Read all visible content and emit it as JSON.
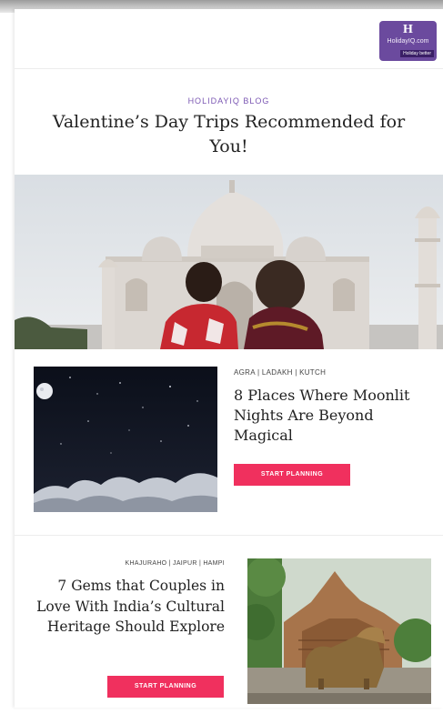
{
  "logo": {
    "mark": "H",
    "name": "HolidayIQ.com",
    "tagline": "Holiday better"
  },
  "header": {
    "eyebrow": "HOLIDAYIQ BLOG",
    "headline": "Valentine’s Day Trips Recommended for You!"
  },
  "articles": [
    {
      "tags": "AGRA | LADAKH | KUTCH",
      "title": "8 Places Where Moonlit Nights Are Beyond Magical",
      "cta": "START PLANNING"
    },
    {
      "tags": "KHAJURAHO | JAIPUR | HAMPI",
      "title": "7 Gems that Couples in Love With India’s Cultural Heritage Should Explore",
      "cta": "START PLANNING"
    }
  ],
  "colors": {
    "brand": "#6b4a9e",
    "eyebrow": "#7b57b3",
    "cta": "#f0305e"
  }
}
